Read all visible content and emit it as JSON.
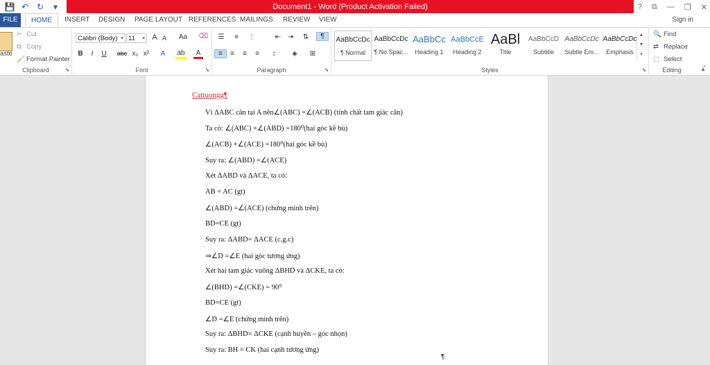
{
  "title_bar": {
    "title": "Document1 - Word (Product Activation Failed)",
    "help": "?",
    "ribbon_options": "⧉",
    "minimize": "—",
    "restore": "❐",
    "close": "✕"
  },
  "quick_access": {
    "save": "💾",
    "undo": "↶",
    "redo": "↻",
    "customize": "▾"
  },
  "tabs": {
    "file": "FILE",
    "home": "HOME",
    "insert": "INSERT",
    "design": "DESIGN",
    "page_layout": "PAGE LAYOUT",
    "references": "REFERENCES",
    "mailings": "MAILINGS",
    "review": "REVIEW",
    "view": "VIEW",
    "sign_in": "Sign in"
  },
  "clipboard": {
    "paste": "aste",
    "cut": "Cut",
    "copy": "Copy",
    "format_painter": "Format Painter",
    "label": "Clipboard"
  },
  "font": {
    "family": "Calibri (Body)",
    "size": "11",
    "grow": "A",
    "shrink": "A",
    "change_case": "Aa",
    "bold": "B",
    "italic": "I",
    "underline": "U",
    "strike": "abc",
    "subscript": "x₂",
    "superscript": "x²",
    "text_effects": "A",
    "highlight": "ab",
    "font_color": "A",
    "label": "Font"
  },
  "paragraph": {
    "label": "Paragraph",
    "show_marks": "¶"
  },
  "styles": {
    "label": "Styles",
    "items": [
      {
        "preview": "AaBbCcDc",
        "name": "¶ Normal"
      },
      {
        "preview": "AaBbCcDc",
        "name": "¶ No Spac..."
      },
      {
        "preview": "AaBbCc",
        "name": "Heading 1"
      },
      {
        "preview": "AaBbCcE",
        "name": "Heading 2"
      },
      {
        "preview": "AaBl",
        "name": "Title"
      },
      {
        "preview": "AaBbCcD",
        "name": "Subtitle"
      },
      {
        "preview": "AaBbCcDc",
        "name": "Subtle Em..."
      },
      {
        "preview": "AaBbCcDc",
        "name": "Emphasis"
      }
    ]
  },
  "editing": {
    "find": "Find",
    "replace": "Replace",
    "select": "Select",
    "label": "Editing"
  },
  "document": {
    "title": "Cattuongg¶",
    "lines": [
      "Vì ΔABC cân tại A nên∠(ABC) =∠(ACB) (tính chất tam giác cân)",
      "Ta có: ∠(ABC) +∠(ABD) =180⁰(hai góc kề bù)",
      "∠(ACB) +∠(ACE) =180⁰(hai góc kề bù)",
      "Suy ra: ∠(ABD) =∠(ACE)",
      "Xét ΔABD và ΔACE, ta có:",
      "AB = AC (gt)",
      "∠(ABD) =∠(ACE) (chứng minh trên)",
      "BD=CE (gt)",
      "Suy ra: ΔABD= ΔACE (c.g.c)",
      "⇒∠D =∠E (hai góc tương ứng)",
      "Xét hai tam giác vuông ΔBHD và ΔCKE, ta có:",
      "∠(BHD) =∠(CKE) = 90⁰",
      "BD=CE (gt)",
      "∠D =∠E (chứng minh trên)",
      "Suy ra: ΔBHD= ΔCKE (cạnh huyền – góc nhọn)",
      "Suy ra: BH = CK (hai cạnh tương ứng)"
    ],
    "end_mark": "¶"
  }
}
